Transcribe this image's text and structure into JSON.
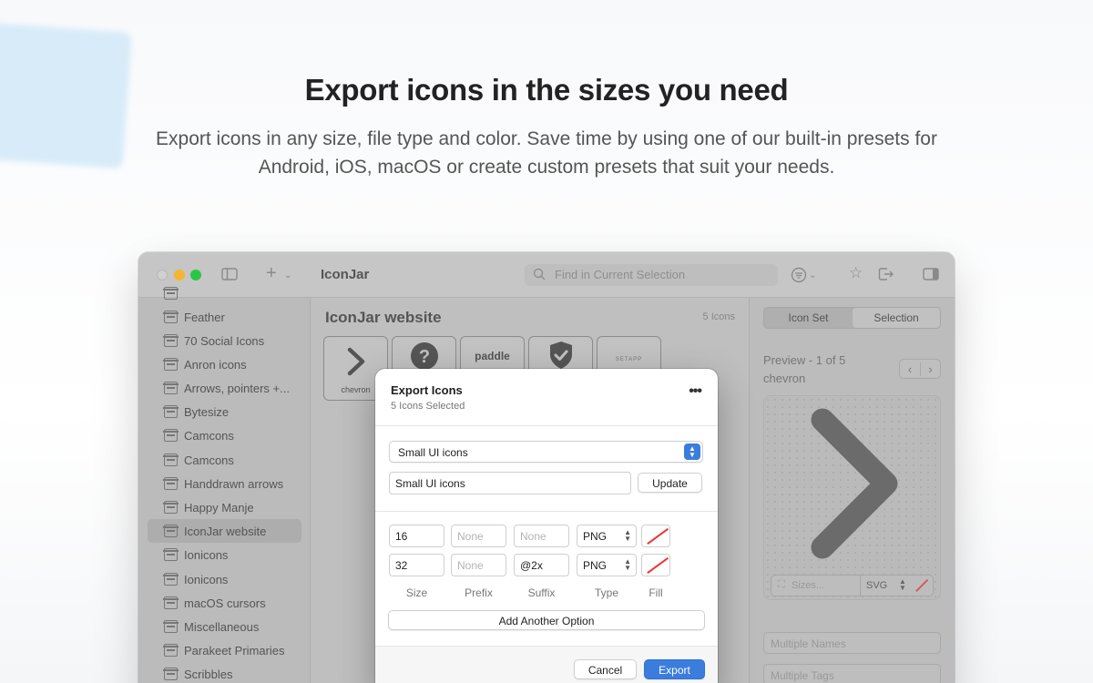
{
  "hero": {
    "title": "Export icons in the sizes you need",
    "subtitle": "Export icons in any size, file type and color. Save time by using one of our built-in presets for Android, iOS, macOS or create custom presets that suit your needs."
  },
  "window": {
    "title": "IconJar",
    "search_placeholder": "Find in Current Selection",
    "sidebar": {
      "items": [
        {
          "label": "Feather"
        },
        {
          "label": "70 Social Icons"
        },
        {
          "label": "Anron icons"
        },
        {
          "label": "Arrows, pointers +..."
        },
        {
          "label": "Bytesize"
        },
        {
          "label": "Camcons"
        },
        {
          "label": "Camcons"
        },
        {
          "label": "Handdrawn arrows"
        },
        {
          "label": "Happy Manje"
        },
        {
          "label": "IconJar website",
          "selected": true
        },
        {
          "label": "Ionicons"
        },
        {
          "label": "Ionicons"
        },
        {
          "label": "macOS cursors"
        },
        {
          "label": "Miscellaneous"
        },
        {
          "label": "Parakeet Primaries"
        },
        {
          "label": "Scribbles"
        }
      ]
    },
    "main": {
      "title": "IconJar website",
      "count": "5 Icons",
      "tiles": [
        {
          "label": "chevron",
          "icon": "chevron-right-icon"
        },
        {
          "label": "",
          "icon": "question-circle-icon"
        },
        {
          "label": "paddle",
          "icon": "paddle-logo"
        },
        {
          "label": "",
          "icon": "shield-check-icon"
        },
        {
          "label": "SETAPP",
          "icon": "setapp-logo"
        }
      ]
    },
    "inspector": {
      "tab_icon_set": "Icon Set",
      "tab_selection": "Selection",
      "preview_title": "Preview - 1 of 5",
      "preview_name": "chevron",
      "sizes_placeholder": "Sizes...",
      "format": "SVG",
      "names_placeholder": "Multiple Names",
      "tags_placeholder": "Multiple Tags"
    }
  },
  "dialog": {
    "title": "Export Icons",
    "subtitle": "5 Icons Selected",
    "preset_select": "Small UI icons",
    "preset_name": "Small UI icons",
    "update_label": "Update",
    "rows": [
      {
        "size": "16",
        "prefix": "",
        "prefix_placeholder": "None",
        "suffix": "",
        "suffix_placeholder": "None",
        "type": "PNG"
      },
      {
        "size": "32",
        "prefix": "",
        "prefix_placeholder": "None",
        "suffix": "@2x",
        "suffix_placeholder": "None",
        "type": "PNG"
      }
    ],
    "columns": {
      "size": "Size",
      "prefix": "Prefix",
      "suffix": "Suffix",
      "type": "Type",
      "fill": "Fill"
    },
    "add_option_label": "Add Another Option",
    "cancel_label": "Cancel",
    "export_label": "Export"
  },
  "colors": {
    "accent": "#3b7ddd",
    "fill_none_red": "#e33333"
  }
}
